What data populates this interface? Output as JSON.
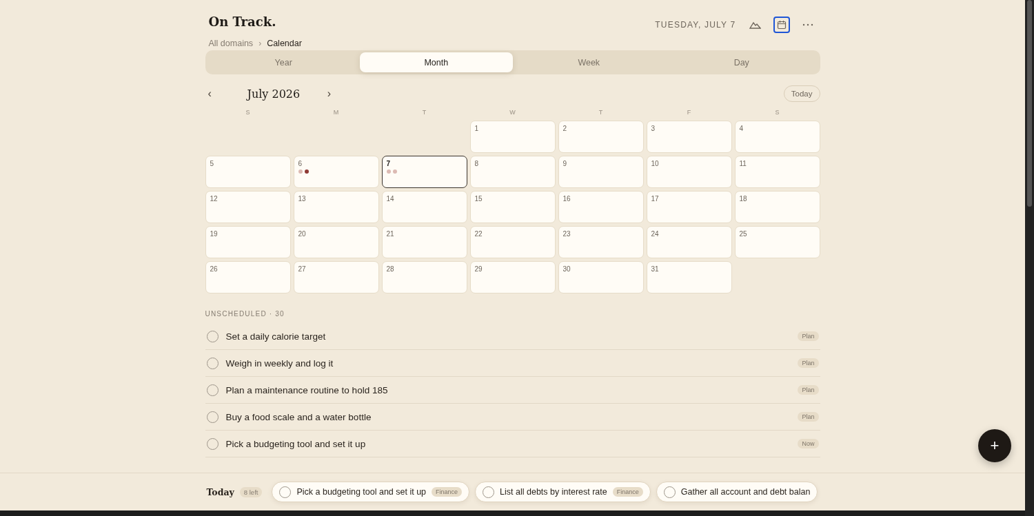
{
  "app": {
    "title": "On Track.",
    "date": "TUESDAY, JULY 7"
  },
  "breadcrumb": [
    {
      "label": "All domains",
      "current": false
    },
    {
      "label": "Calendar",
      "current": true
    }
  ],
  "separator": "›",
  "tabs": [
    {
      "label": "Year",
      "selected": false
    },
    {
      "label": "Month",
      "selected": true
    },
    {
      "label": "Week",
      "selected": false
    },
    {
      "label": "Day",
      "selected": false
    }
  ],
  "month_nav": {
    "prev": "‹",
    "title": "July 2026",
    "next": "›",
    "today_button": "Today"
  },
  "weekdays": [
    "S",
    "M",
    "T",
    "W",
    "T",
    "F",
    "S"
  ],
  "weeks": [
    [
      {
        "kind": "blank"
      },
      {
        "kind": "blank"
      },
      {
        "kind": "blank"
      },
      {
        "kind": "day",
        "day": "1",
        "today": false
      },
      {
        "kind": "day",
        "day": "2",
        "today": false
      },
      {
        "kind": "day",
        "day": "3",
        "today": false
      },
      {
        "kind": "day",
        "day": "4",
        "today": false
      }
    ],
    [
      {
        "kind": "day",
        "day": "5",
        "today": false
      },
      {
        "kind": "day",
        "day": "6",
        "today": false,
        "dots": [
          {
            "color": "#dcbab3"
          },
          {
            "color": "#8f3a35"
          }
        ]
      },
      {
        "kind": "day",
        "day": "7",
        "today": true,
        "dots": [
          {
            "color": "#dcbab3"
          },
          {
            "color": "#dcbab3"
          }
        ]
      },
      {
        "kind": "day",
        "day": "8",
        "today": false
      },
      {
        "kind": "day",
        "day": "9",
        "today": false
      },
      {
        "kind": "day",
        "day": "10",
        "today": false
      },
      {
        "kind": "day",
        "day": "11",
        "today": false
      }
    ],
    [
      {
        "kind": "day",
        "day": "12",
        "today": false
      },
      {
        "kind": "day",
        "day": "13",
        "today": false
      },
      {
        "kind": "day",
        "day": "14",
        "today": false
      },
      {
        "kind": "day",
        "day": "15",
        "today": false
      },
      {
        "kind": "day",
        "day": "16",
        "today": false
      },
      {
        "kind": "day",
        "day": "17",
        "today": false
      },
      {
        "kind": "day",
        "day": "18",
        "today": false
      }
    ],
    [
      {
        "kind": "day",
        "day": "19",
        "today": false
      },
      {
        "kind": "day",
        "day": "20",
        "today": false
      },
      {
        "kind": "day",
        "day": "21",
        "today": false
      },
      {
        "kind": "day",
        "day": "22",
        "today": false
      },
      {
        "kind": "day",
        "day": "23",
        "today": false
      },
      {
        "kind": "day",
        "day": "24",
        "today": false
      },
      {
        "kind": "day",
        "day": "25",
        "today": false
      }
    ],
    [
      {
        "kind": "day",
        "day": "26",
        "today": false
      },
      {
        "kind": "day",
        "day": "27",
        "today": false
      },
      {
        "kind": "day",
        "day": "28",
        "today": false
      },
      {
        "kind": "day",
        "day": "29",
        "today": false
      },
      {
        "kind": "day",
        "day": "30",
        "today": false
      },
      {
        "kind": "day",
        "day": "31",
        "today": false
      },
      {
        "kind": "blank"
      }
    ]
  ],
  "unscheduled": {
    "heading": "UNSCHEDULED · 30",
    "tasks": [
      {
        "title": "Set a daily calorie target",
        "tag": "Plan",
        "checked": false
      },
      {
        "title": "Weigh in weekly and log it",
        "tag": "Plan",
        "checked": false
      },
      {
        "title": "Plan a maintenance routine to hold 185",
        "tag": "Plan",
        "checked": false
      },
      {
        "title": "Buy a food scale and a water bottle",
        "tag": "Plan",
        "checked": false
      },
      {
        "title": "Pick a budgeting tool and set it up",
        "tag": "Now",
        "checked": false
      }
    ]
  },
  "today_bar": {
    "title": "Today",
    "count": "8 left",
    "tasks": [
      {
        "title": "Pick a budgeting tool and set it up",
        "tag": "Finance",
        "checked": false
      },
      {
        "title": "List all debts by interest rate",
        "tag": "Finance",
        "checked": false
      },
      {
        "title": "Gather all account and debt balan",
        "checked": false
      }
    ]
  },
  "fab": "+"
}
